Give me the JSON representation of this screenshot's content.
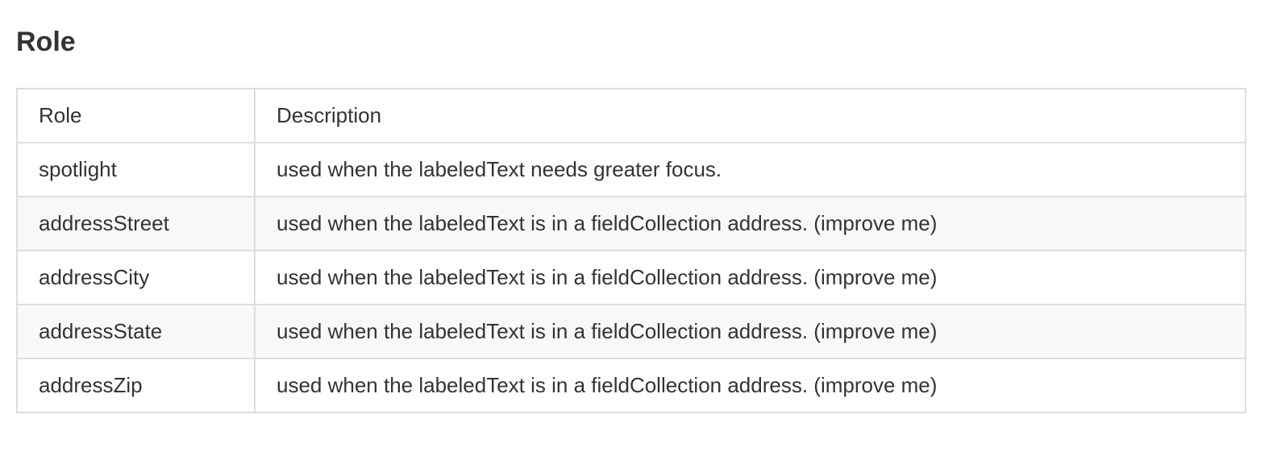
{
  "section": {
    "title": "Role"
  },
  "table": {
    "headers": {
      "role": "Role",
      "description": "Description"
    },
    "rows": [
      {
        "role": "spotlight",
        "description": "used when the labeledText needs greater focus."
      },
      {
        "role": "addressStreet",
        "description": "used when the labeledText is in a fieldCollection address. (improve me)"
      },
      {
        "role": "addressCity",
        "description": "used when the labeledText is in a fieldCollection address. (improve me)"
      },
      {
        "role": "addressState",
        "description": "used when the labeledText is in a fieldCollection address. (improve me)"
      },
      {
        "role": "addressZip",
        "description": "used when the labeledText is in a fieldCollection address. (improve me)"
      }
    ]
  }
}
